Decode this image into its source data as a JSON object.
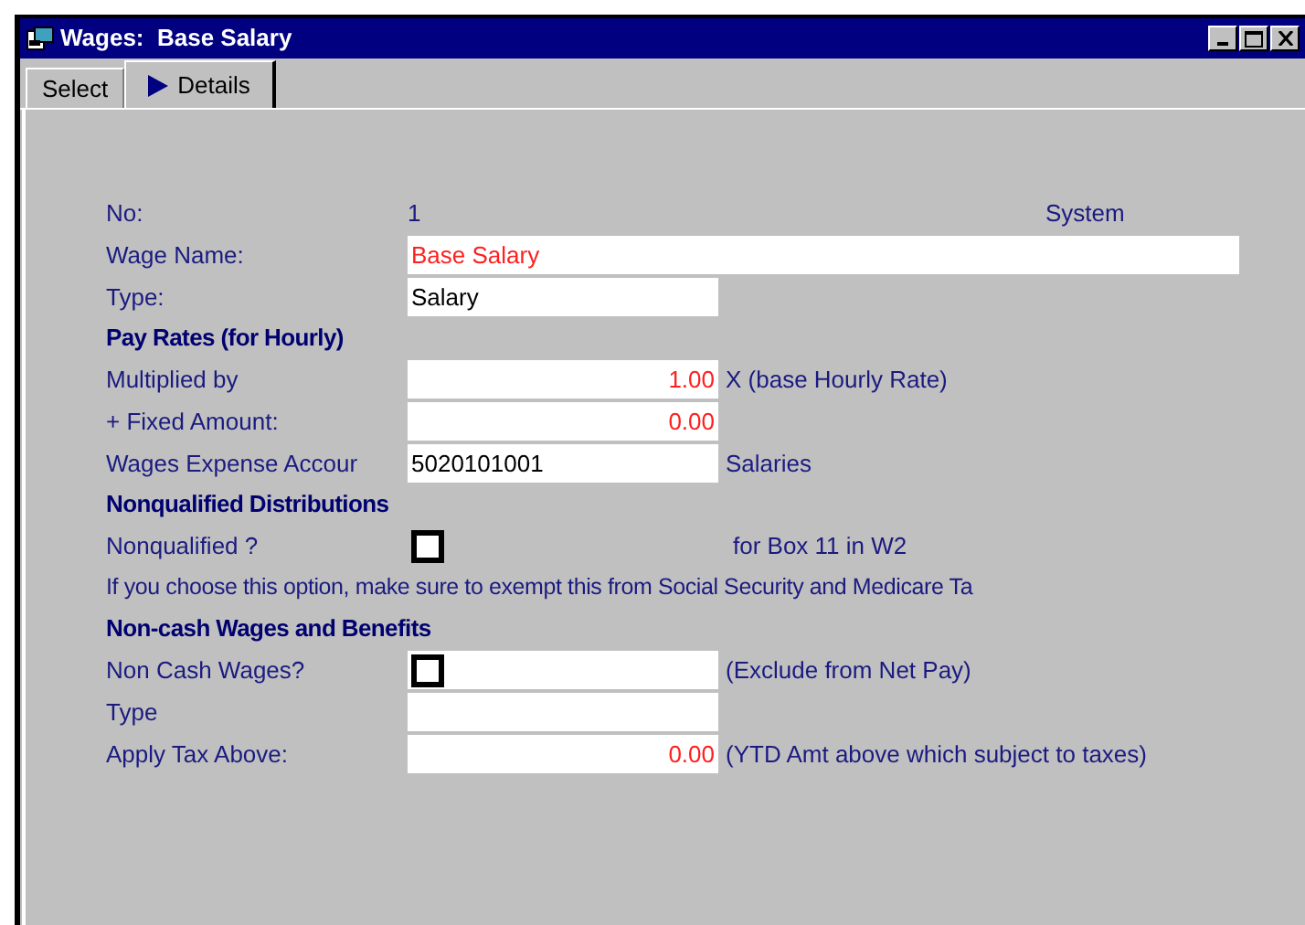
{
  "window": {
    "title": "Wages:  Base Salary"
  },
  "tabs": [
    {
      "label": "Select",
      "selected": false
    },
    {
      "label": "Details",
      "selected": true
    }
  ],
  "rows": [
    {
      "kind": "info",
      "label": "No:",
      "value": "1",
      "suffix": "System"
    },
    {
      "kind": "wide_field",
      "label": "Wage Name:",
      "value": "Base Salary"
    },
    {
      "kind": "text_field",
      "label": "Type:",
      "value": "Salary"
    },
    {
      "kind": "heading",
      "label": "Pay Rates (for Hourly)"
    },
    {
      "kind": "amount_field",
      "label": "Multiplied by",
      "value": "1.00",
      "suffix": "X (base Hourly Rate)"
    },
    {
      "kind": "amount_field",
      "label": "+ Fixed Amount:",
      "value": "0.00"
    },
    {
      "kind": "text_field",
      "label": "Wages Expense Accour",
      "value": "5020101001",
      "suffix": "Salaries"
    },
    {
      "kind": "heading",
      "label": "Nonqualified Distributions"
    },
    {
      "kind": "checkbox",
      "label": "Nonqualified ?",
      "checked": false,
      "boxed": false,
      "suffix": "for Box 11 in W2"
    },
    {
      "kind": "note",
      "label": "If you choose this option, make sure to exempt this from Social Security and Medicare Ta"
    },
    {
      "kind": "heading",
      "label": "Non-cash Wages and Benefits"
    },
    {
      "kind": "checkbox",
      "label": "Non Cash Wages?",
      "checked": false,
      "boxed": true,
      "suffix": "(Exclude from Net Pay)"
    },
    {
      "kind": "text_field",
      "label": "Type"
    },
    {
      "kind": "amount_field",
      "label": "Apply Tax Above:",
      "value": "0.00",
      "suffix": "(YTD Amt above which subject to taxes)"
    }
  ]
}
